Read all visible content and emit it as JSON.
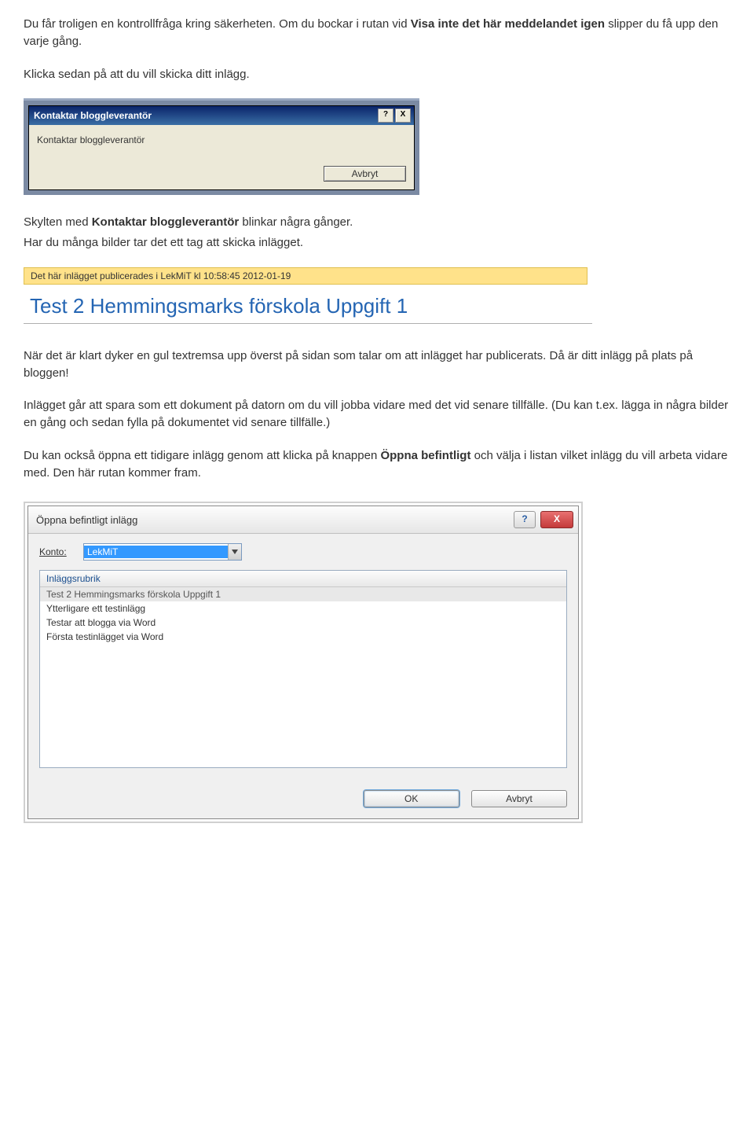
{
  "para1": {
    "pre": "Du får troligen en kontrollfråga kring säkerheten. Om du bockar i rutan vid ",
    "bold": "Visa inte det här meddelandet igen",
    "post": " slipper du få upp den varje gång."
  },
  "para2": "Klicka sedan på att du vill skicka ditt inlägg.",
  "dlg1": {
    "title": "Kontaktar bloggleverantör",
    "help": "?",
    "close": "X",
    "message": "Kontaktar bloggleverantör",
    "cancel": "Avbryt"
  },
  "para3": {
    "pre": "Skylten med ",
    "bold": "Kontaktar bloggleverantör",
    "post": " blinkar några gånger."
  },
  "para4": "Har du många bilder tar det ett tag att skicka inlägget.",
  "banner": "Det här inlägget publicerades i LekMiT kl 10:58:45 2012-01-19",
  "post_title": "Test 2 Hemmingsmarks förskola Uppgift 1",
  "para5": "När det är klart dyker en gul textremsa upp överst på sidan som talar om att inlägget har publicerats. Då är ditt inlägg på plats på bloggen!",
  "para6": "Inlägget går att spara som ett dokument på datorn om du vill jobba vidare med det vid senare tillfälle. (Du kan t.ex. lägga in några bilder en gång och sedan fylla på dokumentet vid senare tillfälle.)",
  "para7": {
    "pre": "Du kan också öppna ett tidigare inlägg genom att klicka på knappen ",
    "bold": "Öppna befintligt",
    "post": " och välja i listan vilket inlägg du vill arbeta vidare med. Den här rutan kommer fram."
  },
  "dlg2": {
    "title": "Öppna befintligt inlägg",
    "help": "?",
    "close": "X",
    "konto_label": "Konto:",
    "konto_value": "LekMiT",
    "list_header": "Inläggsrubrik",
    "items": [
      "Test 2 Hemmingsmarks förskola Uppgift 1",
      "Ytterligare ett testinlägg",
      "Testar att blogga via Word",
      "Första testinlägget via Word"
    ],
    "ok": "OK",
    "cancel": "Avbryt"
  }
}
